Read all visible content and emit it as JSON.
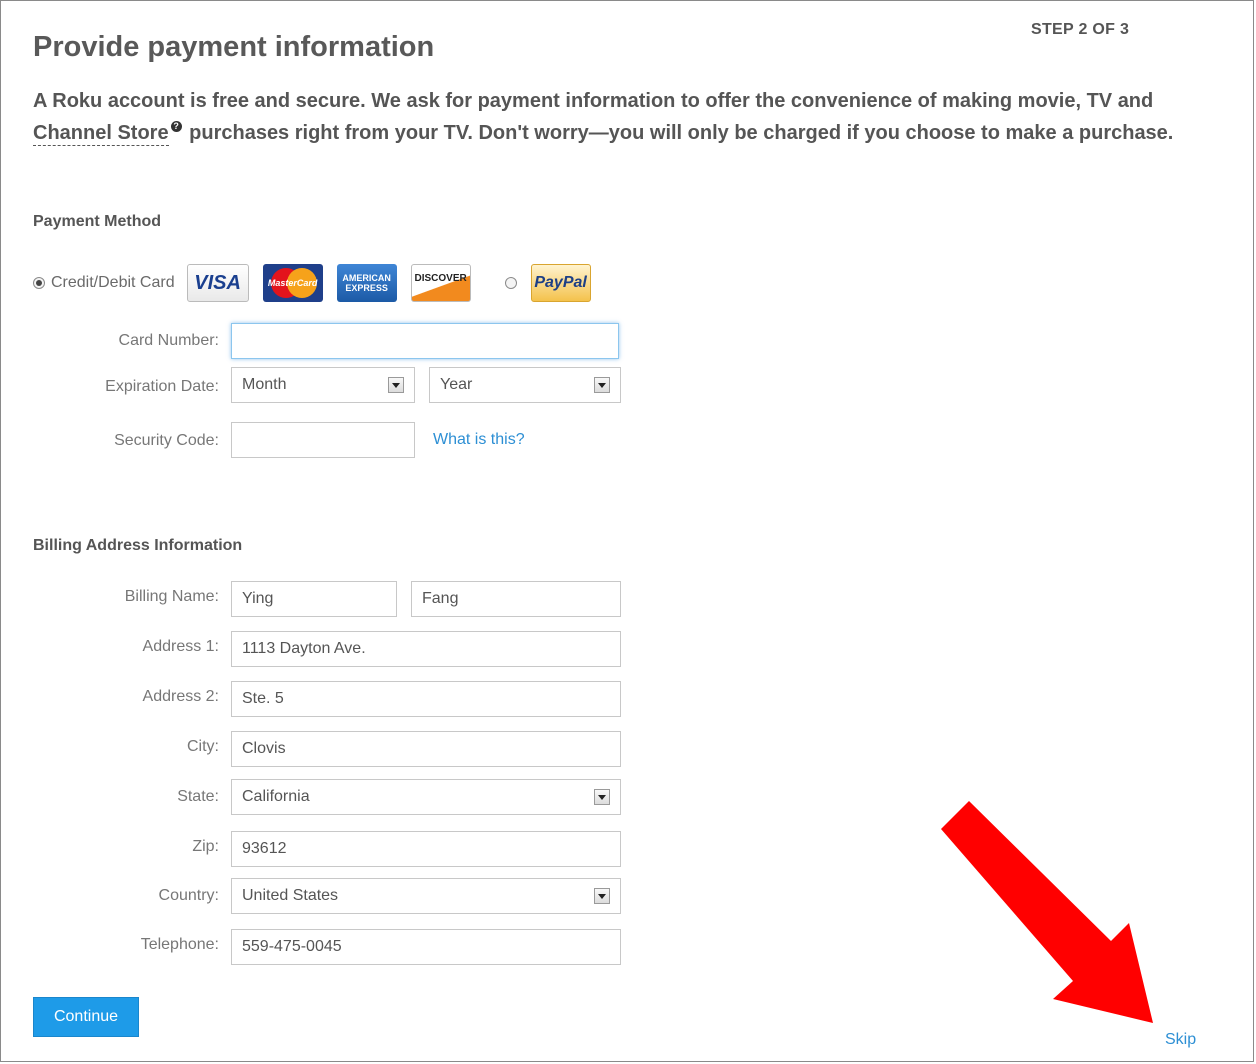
{
  "header": {
    "step": "STEP 2 OF 3",
    "title": "Provide payment information",
    "intro_before_link": "A Roku account is free and secure. We ask for payment information to offer the convenience of making movie, TV and ",
    "intro_link": "Channel Store",
    "help_icon_glyph": "?",
    "intro_after_link": " purchases right from your TV. Don't worry—you will only be charged if you choose to make a purchase."
  },
  "payment": {
    "section_title": "Payment Method",
    "credit_label": "Credit/Debit Card",
    "credit_selected": true,
    "paypal_selected": false,
    "cards": {
      "visa": "VISA",
      "mastercard": "MasterCard",
      "amex_line1": "AMERICAN",
      "amex_line2": "EXPRESS",
      "discover": "DISCOVER",
      "paypal": "PayPal"
    },
    "card_number_label": "Card Number:",
    "card_number_value": "",
    "expiration_label": "Expiration Date:",
    "month_value": "Month",
    "year_value": "Year",
    "security_label": "Security Code:",
    "security_value": "",
    "what_is_this": "What is this?"
  },
  "billing": {
    "section_title": "Billing Address Information",
    "name_label": "Billing Name:",
    "first_name": "Ying",
    "last_name": "Fang",
    "address1_label": "Address 1:",
    "address1": "1113 Dayton Ave.",
    "address2_label": "Address 2:",
    "address2": "Ste. 5",
    "city_label": "City:",
    "city": "Clovis",
    "state_label": "State:",
    "state": "California",
    "zip_label": "Zip:",
    "zip": "93612",
    "country_label": "Country:",
    "country": "United States",
    "telephone_label": "Telephone:",
    "telephone": "559-475-0045"
  },
  "actions": {
    "continue_label": "Continue",
    "skip_label": "Skip"
  },
  "colors": {
    "link": "#2d8fd4",
    "button": "#1e9be8",
    "annotation_arrow": "#ff0000"
  }
}
